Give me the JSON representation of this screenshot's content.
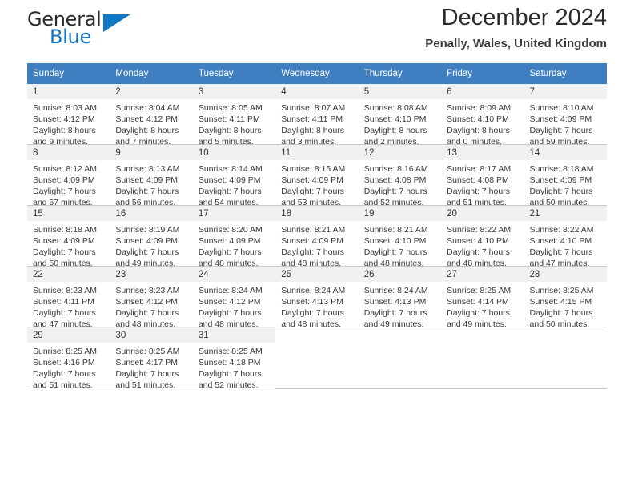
{
  "brand": {
    "word1": "General",
    "word2": "Blue",
    "triangle_color": "#1277c4",
    "icon": "triangle-logo-icon"
  },
  "header": {
    "title": "December 2024",
    "location": "Penally, Wales, United Kingdom"
  },
  "calendar": {
    "header_bg": "#3f7fc1",
    "daynum_bg": "#f1f1f1",
    "weekdays": [
      "Sunday",
      "Monday",
      "Tuesday",
      "Wednesday",
      "Thursday",
      "Friday",
      "Saturday"
    ],
    "weeks": [
      [
        {
          "day": "1",
          "sunrise": "Sunrise: 8:03 AM",
          "sunset": "Sunset: 4:12 PM",
          "daylight1": "Daylight: 8 hours",
          "daylight2": "and 9 minutes."
        },
        {
          "day": "2",
          "sunrise": "Sunrise: 8:04 AM",
          "sunset": "Sunset: 4:12 PM",
          "daylight1": "Daylight: 8 hours",
          "daylight2": "and 7 minutes."
        },
        {
          "day": "3",
          "sunrise": "Sunrise: 8:05 AM",
          "sunset": "Sunset: 4:11 PM",
          "daylight1": "Daylight: 8 hours",
          "daylight2": "and 5 minutes."
        },
        {
          "day": "4",
          "sunrise": "Sunrise: 8:07 AM",
          "sunset": "Sunset: 4:11 PM",
          "daylight1": "Daylight: 8 hours",
          "daylight2": "and 3 minutes."
        },
        {
          "day": "5",
          "sunrise": "Sunrise: 8:08 AM",
          "sunset": "Sunset: 4:10 PM",
          "daylight1": "Daylight: 8 hours",
          "daylight2": "and 2 minutes."
        },
        {
          "day": "6",
          "sunrise": "Sunrise: 8:09 AM",
          "sunset": "Sunset: 4:10 PM",
          "daylight1": "Daylight: 8 hours",
          "daylight2": "and 0 minutes."
        },
        {
          "day": "7",
          "sunrise": "Sunrise: 8:10 AM",
          "sunset": "Sunset: 4:09 PM",
          "daylight1": "Daylight: 7 hours",
          "daylight2": "and 59 minutes."
        }
      ],
      [
        {
          "day": "8",
          "sunrise": "Sunrise: 8:12 AM",
          "sunset": "Sunset: 4:09 PM",
          "daylight1": "Daylight: 7 hours",
          "daylight2": "and 57 minutes."
        },
        {
          "day": "9",
          "sunrise": "Sunrise: 8:13 AM",
          "sunset": "Sunset: 4:09 PM",
          "daylight1": "Daylight: 7 hours",
          "daylight2": "and 56 minutes."
        },
        {
          "day": "10",
          "sunrise": "Sunrise: 8:14 AM",
          "sunset": "Sunset: 4:09 PM",
          "daylight1": "Daylight: 7 hours",
          "daylight2": "and 54 minutes."
        },
        {
          "day": "11",
          "sunrise": "Sunrise: 8:15 AM",
          "sunset": "Sunset: 4:09 PM",
          "daylight1": "Daylight: 7 hours",
          "daylight2": "and 53 minutes."
        },
        {
          "day": "12",
          "sunrise": "Sunrise: 8:16 AM",
          "sunset": "Sunset: 4:08 PM",
          "daylight1": "Daylight: 7 hours",
          "daylight2": "and 52 minutes."
        },
        {
          "day": "13",
          "sunrise": "Sunrise: 8:17 AM",
          "sunset": "Sunset: 4:08 PM",
          "daylight1": "Daylight: 7 hours",
          "daylight2": "and 51 minutes."
        },
        {
          "day": "14",
          "sunrise": "Sunrise: 8:18 AM",
          "sunset": "Sunset: 4:09 PM",
          "daylight1": "Daylight: 7 hours",
          "daylight2": "and 50 minutes."
        }
      ],
      [
        {
          "day": "15",
          "sunrise": "Sunrise: 8:18 AM",
          "sunset": "Sunset: 4:09 PM",
          "daylight1": "Daylight: 7 hours",
          "daylight2": "and 50 minutes."
        },
        {
          "day": "16",
          "sunrise": "Sunrise: 8:19 AM",
          "sunset": "Sunset: 4:09 PM",
          "daylight1": "Daylight: 7 hours",
          "daylight2": "and 49 minutes."
        },
        {
          "day": "17",
          "sunrise": "Sunrise: 8:20 AM",
          "sunset": "Sunset: 4:09 PM",
          "daylight1": "Daylight: 7 hours",
          "daylight2": "and 48 minutes."
        },
        {
          "day": "18",
          "sunrise": "Sunrise: 8:21 AM",
          "sunset": "Sunset: 4:09 PM",
          "daylight1": "Daylight: 7 hours",
          "daylight2": "and 48 minutes."
        },
        {
          "day": "19",
          "sunrise": "Sunrise: 8:21 AM",
          "sunset": "Sunset: 4:10 PM",
          "daylight1": "Daylight: 7 hours",
          "daylight2": "and 48 minutes."
        },
        {
          "day": "20",
          "sunrise": "Sunrise: 8:22 AM",
          "sunset": "Sunset: 4:10 PM",
          "daylight1": "Daylight: 7 hours",
          "daylight2": "and 48 minutes."
        },
        {
          "day": "21",
          "sunrise": "Sunrise: 8:22 AM",
          "sunset": "Sunset: 4:10 PM",
          "daylight1": "Daylight: 7 hours",
          "daylight2": "and 47 minutes."
        }
      ],
      [
        {
          "day": "22",
          "sunrise": "Sunrise: 8:23 AM",
          "sunset": "Sunset: 4:11 PM",
          "daylight1": "Daylight: 7 hours",
          "daylight2": "and 47 minutes."
        },
        {
          "day": "23",
          "sunrise": "Sunrise: 8:23 AM",
          "sunset": "Sunset: 4:12 PM",
          "daylight1": "Daylight: 7 hours",
          "daylight2": "and 48 minutes."
        },
        {
          "day": "24",
          "sunrise": "Sunrise: 8:24 AM",
          "sunset": "Sunset: 4:12 PM",
          "daylight1": "Daylight: 7 hours",
          "daylight2": "and 48 minutes."
        },
        {
          "day": "25",
          "sunrise": "Sunrise: 8:24 AM",
          "sunset": "Sunset: 4:13 PM",
          "daylight1": "Daylight: 7 hours",
          "daylight2": "and 48 minutes."
        },
        {
          "day": "26",
          "sunrise": "Sunrise: 8:24 AM",
          "sunset": "Sunset: 4:13 PM",
          "daylight1": "Daylight: 7 hours",
          "daylight2": "and 49 minutes."
        },
        {
          "day": "27",
          "sunrise": "Sunrise: 8:25 AM",
          "sunset": "Sunset: 4:14 PM",
          "daylight1": "Daylight: 7 hours",
          "daylight2": "and 49 minutes."
        },
        {
          "day": "28",
          "sunrise": "Sunrise: 8:25 AM",
          "sunset": "Sunset: 4:15 PM",
          "daylight1": "Daylight: 7 hours",
          "daylight2": "and 50 minutes."
        }
      ],
      [
        {
          "day": "29",
          "sunrise": "Sunrise: 8:25 AM",
          "sunset": "Sunset: 4:16 PM",
          "daylight1": "Daylight: 7 hours",
          "daylight2": "and 51 minutes."
        },
        {
          "day": "30",
          "sunrise": "Sunrise: 8:25 AM",
          "sunset": "Sunset: 4:17 PM",
          "daylight1": "Daylight: 7 hours",
          "daylight2": "and 51 minutes."
        },
        {
          "day": "31",
          "sunrise": "Sunrise: 8:25 AM",
          "sunset": "Sunset: 4:18 PM",
          "daylight1": "Daylight: 7 hours",
          "daylight2": "and 52 minutes."
        },
        {
          "day": "",
          "sunrise": "",
          "sunset": "",
          "daylight1": "",
          "daylight2": ""
        },
        {
          "day": "",
          "sunrise": "",
          "sunset": "",
          "daylight1": "",
          "daylight2": ""
        },
        {
          "day": "",
          "sunrise": "",
          "sunset": "",
          "daylight1": "",
          "daylight2": ""
        },
        {
          "day": "",
          "sunrise": "",
          "sunset": "",
          "daylight1": "",
          "daylight2": ""
        }
      ]
    ]
  }
}
